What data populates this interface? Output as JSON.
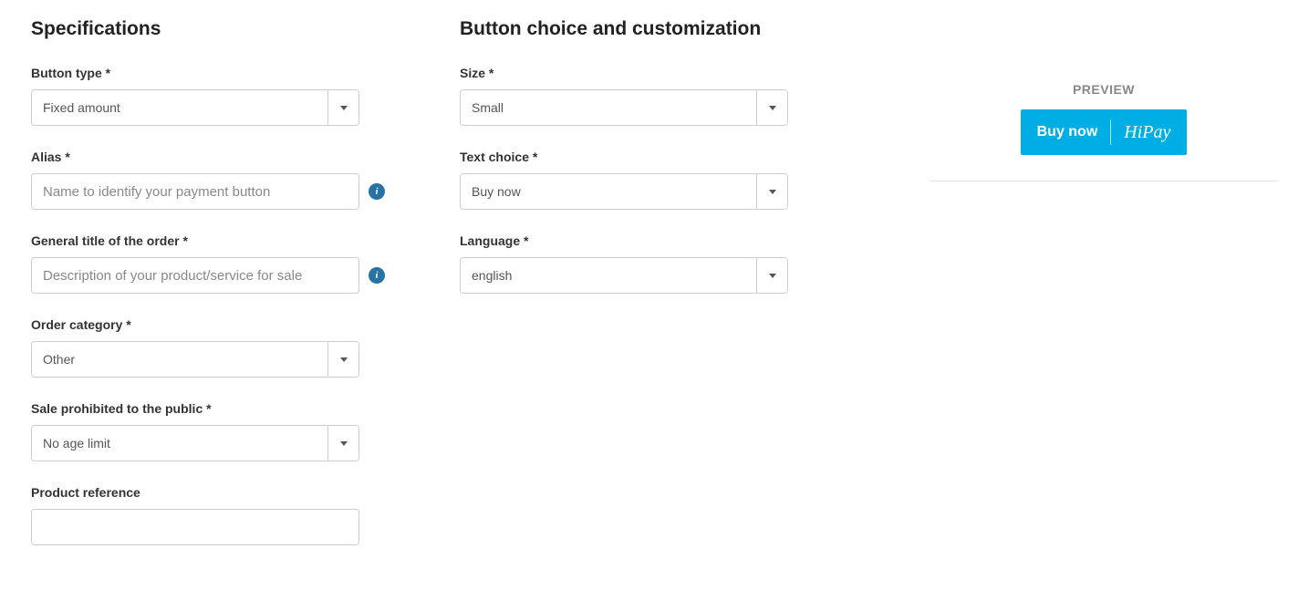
{
  "specs": {
    "heading": "Specifications",
    "button_type": {
      "label": "Button type *",
      "value": "Fixed amount"
    },
    "alias": {
      "label": "Alias *",
      "placeholder": "Name to identify your payment button"
    },
    "general_title": {
      "label": "General title of the order *",
      "placeholder": "Description of your product/service for sale"
    },
    "order_category": {
      "label": "Order category *",
      "value": "Other"
    },
    "sale_prohibited": {
      "label": "Sale prohibited to the public *",
      "value": "No age limit"
    },
    "product_reference": {
      "label": "Product reference",
      "value": ""
    }
  },
  "customization": {
    "heading": "Button choice and customization",
    "size": {
      "label": "Size *",
      "value": "Small"
    },
    "text_choice": {
      "label": "Text choice *",
      "value": "Buy now"
    },
    "language": {
      "label": "Language *",
      "value": "english"
    }
  },
  "preview": {
    "title": "PREVIEW",
    "button_text": "Buy now",
    "brand": "HiPay"
  },
  "icons": {
    "info": "i"
  }
}
